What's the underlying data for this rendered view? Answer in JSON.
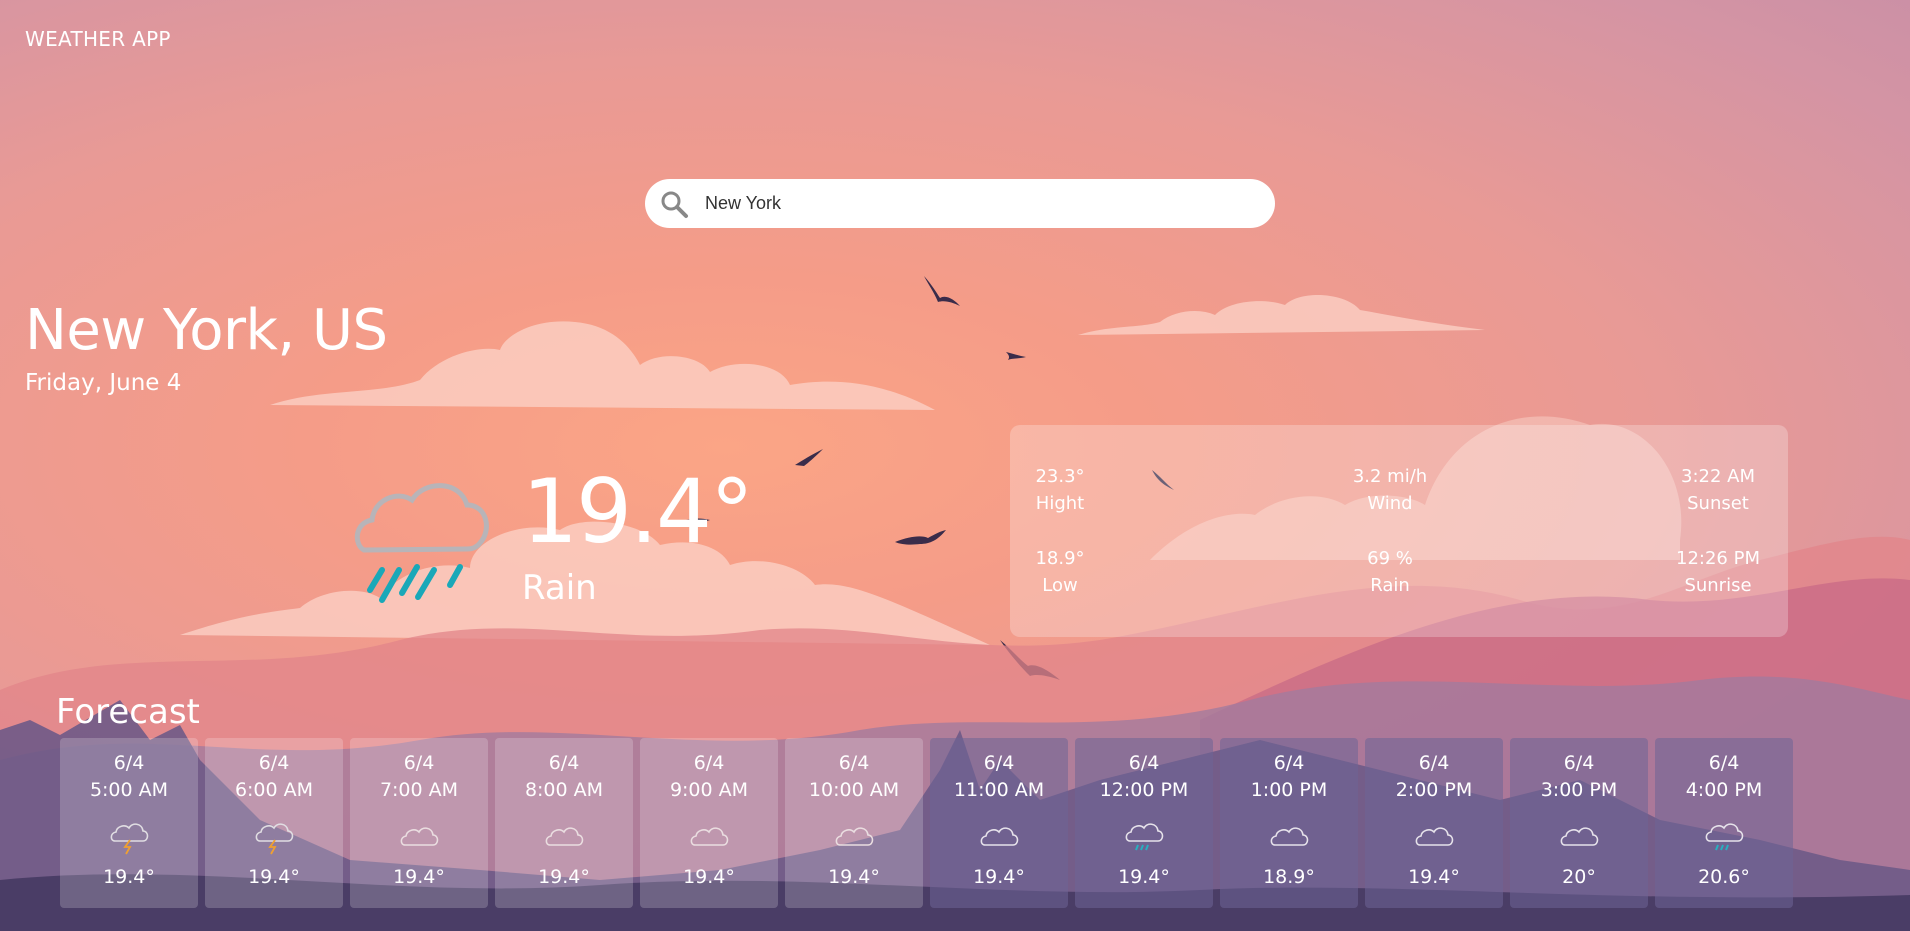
{
  "app": {
    "title": "WEATHER APP"
  },
  "search": {
    "value": "New York",
    "icon": "search-icon"
  },
  "location": {
    "city": "New York, US",
    "date": "Friday, June 4"
  },
  "current": {
    "temperature": "19.4°",
    "condition": "Rain",
    "icon": "rain-cloud-icon"
  },
  "details": {
    "high": {
      "value": "23.3°",
      "label": "Hight"
    },
    "low": {
      "value": "18.9°",
      "label": "Low"
    },
    "wind": {
      "value": "3.2 mi/h",
      "label": "Wind"
    },
    "rain": {
      "value": "69 %",
      "label": "Rain"
    },
    "sunset": {
      "value": "3:22 AM",
      "label": "Sunset"
    },
    "sunrise": {
      "value": "12:26 PM",
      "label": "Sunrise"
    }
  },
  "forecast": {
    "title": "Forecast",
    "items": [
      {
        "date": "6/4",
        "time": "5:00 AM",
        "temp": "19.4°",
        "icon": "thunder-cloud-icon"
      },
      {
        "date": "6/4",
        "time": "6:00 AM",
        "temp": "19.4°",
        "icon": "thunder-cloud-icon"
      },
      {
        "date": "6/4",
        "time": "7:00 AM",
        "temp": "19.4°",
        "icon": "cloud-icon"
      },
      {
        "date": "6/4",
        "time": "8:00 AM",
        "temp": "19.4°",
        "icon": "cloud-icon"
      },
      {
        "date": "6/4",
        "time": "9:00 AM",
        "temp": "19.4°",
        "icon": "cloud-icon"
      },
      {
        "date": "6/4",
        "time": "10:00 AM",
        "temp": "19.4°",
        "icon": "cloud-icon"
      },
      {
        "date": "6/4",
        "time": "11:00 AM",
        "temp": "19.4°",
        "icon": "cloud-icon"
      },
      {
        "date": "6/4",
        "time": "12:00 PM",
        "temp": "19.4°",
        "icon": "rain-cloud-icon"
      },
      {
        "date": "6/4",
        "time": "1:00 PM",
        "temp": "18.9°",
        "icon": "cloud-icon"
      },
      {
        "date": "6/4",
        "time": "2:00 PM",
        "temp": "19.4°",
        "icon": "cloud-icon"
      },
      {
        "date": "6/4",
        "time": "3:00 PM",
        "temp": "20°",
        "icon": "cloud-icon"
      },
      {
        "date": "6/4",
        "time": "4:00 PM",
        "temp": "20.6°",
        "icon": "rain-cloud-icon"
      }
    ]
  }
}
